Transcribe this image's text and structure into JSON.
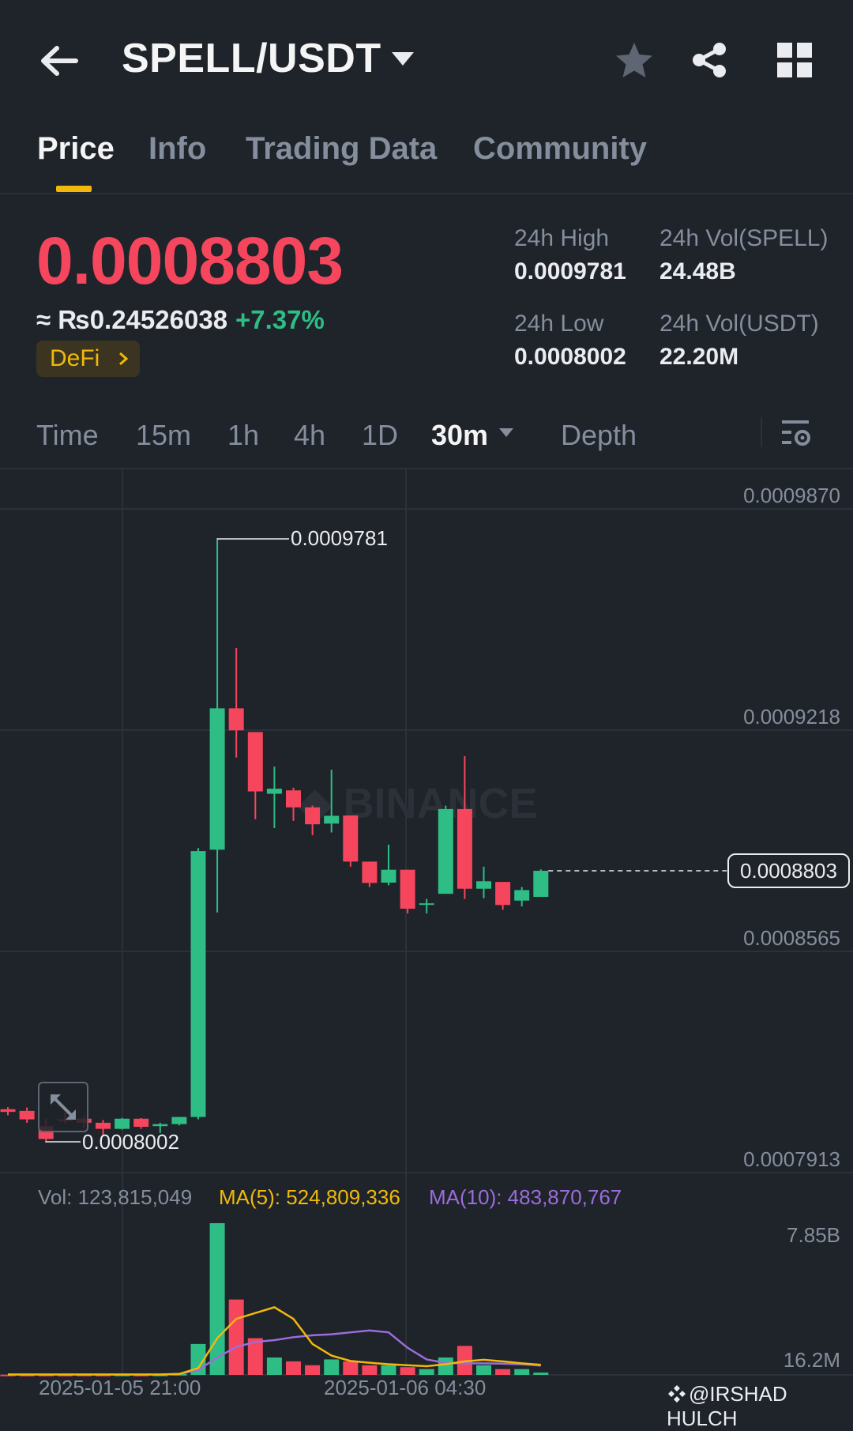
{
  "header": {
    "pair": "SPELL/USDT"
  },
  "tabs": [
    {
      "label": "Price",
      "active": true
    },
    {
      "label": "Info"
    },
    {
      "label": "Trading Data"
    },
    {
      "label": "Community"
    }
  ],
  "ticker": {
    "last_price": "0.0008803",
    "fiat_value": "≈ ₨0.24526038",
    "change_pct": "+7.37%",
    "tag": "DeFi",
    "high_label": "24h High",
    "high_value": "0.0009781",
    "low_label": "24h Low",
    "low_value": "0.0008002",
    "vol_base_label": "24h Vol(SPELL)",
    "vol_base_value": "24.48B",
    "vol_quote_label": "24h Vol(USDT)",
    "vol_quote_value": "22.20M"
  },
  "timeframes": {
    "time": "Time",
    "m15": "15m",
    "h1": "1h",
    "h4": "4h",
    "d1": "1D",
    "selected": "30m",
    "depth": "Depth"
  },
  "chart_data": {
    "type": "candlestick",
    "y_axis_ticks": [
      "0.0009870",
      "0.0009218",
      "0.0008565",
      "0.0007913"
    ],
    "ylim": [
      0.0007913,
      0.000987
    ],
    "high_marker": "0.0009781",
    "low_marker": "0.0008002",
    "current_price_label": "0.0008803",
    "x_labels": [
      "2025-01-05 21:00",
      "2025-01-06 04:30"
    ],
    "candles": [
      {
        "o": 0.00081,
        "h": 0.0008106,
        "l": 0.0008082,
        "c": 0.0008092
      },
      {
        "o": 0.0008095,
        "h": 0.0008105,
        "l": 0.000806,
        "c": 0.000807
      },
      {
        "o": 0.000805,
        "h": 0.0008072,
        "l": 0.0008002,
        "c": 0.0008012
      },
      {
        "o": 0.000807,
        "h": 0.000809,
        "l": 0.0008058,
        "c": 0.0008068
      },
      {
        "o": 0.0008072,
        "h": 0.000808,
        "l": 0.0008045,
        "c": 0.000806
      },
      {
        "o": 0.000806,
        "h": 0.0008068,
        "l": 0.000802,
        "c": 0.0008042
      },
      {
        "o": 0.0008042,
        "h": 0.0008074,
        "l": 0.000804,
        "c": 0.0008072
      },
      {
        "o": 0.0008072,
        "h": 0.0008074,
        "l": 0.0008042,
        "c": 0.0008048
      },
      {
        "o": 0.000805,
        "h": 0.000806,
        "l": 0.000803,
        "c": 0.0008056
      },
      {
        "o": 0.0008056,
        "h": 0.0008077,
        "l": 0.0008052,
        "c": 0.0008077
      },
      {
        "o": 0.0008077,
        "h": 0.000887,
        "l": 0.000807,
        "c": 0.0008861
      },
      {
        "o": 0.0008865,
        "h": 0.0009781,
        "l": 0.000868,
        "c": 0.0009282
      },
      {
        "o": 0.0009282,
        "h": 0.000946,
        "l": 0.0009137,
        "c": 0.0009217
      },
      {
        "o": 0.0009212,
        "h": 0.0009212,
        "l": 0.0008955,
        "c": 0.0009037
      },
      {
        "o": 0.000903,
        "h": 0.000911,
        "l": 0.0008929,
        "c": 0.0009045
      },
      {
        "o": 0.000904,
        "h": 0.0009048,
        "l": 0.000895,
        "c": 0.000899
      },
      {
        "o": 0.000899,
        "h": 0.0008995,
        "l": 0.0008908,
        "c": 0.000894
      },
      {
        "o": 0.0008942,
        "h": 0.0009101,
        "l": 0.0008916,
        "c": 0.0008965
      },
      {
        "o": 0.0008966,
        "h": 0.0008966,
        "l": 0.0008815,
        "c": 0.000883
      },
      {
        "o": 0.000883,
        "h": 0.000883,
        "l": 0.0008755,
        "c": 0.0008767
      },
      {
        "o": 0.0008768,
        "h": 0.000888,
        "l": 0.000876,
        "c": 0.0008806
      },
      {
        "o": 0.0008806,
        "h": 0.0008806,
        "l": 0.0008677,
        "c": 0.0008691
      },
      {
        "o": 0.0008706,
        "h": 0.000872,
        "l": 0.0008677,
        "c": 0.0008707
      },
      {
        "o": 0.0008735,
        "h": 0.0008995,
        "l": 0.0008735,
        "c": 0.0008985
      },
      {
        "o": 0.0008985,
        "h": 0.0009141,
        "l": 0.000872,
        "c": 0.000875
      },
      {
        "o": 0.000875,
        "h": 0.0008815,
        "l": 0.0008722,
        "c": 0.0008772
      },
      {
        "o": 0.000877,
        "h": 0.000877,
        "l": 0.0008688,
        "c": 0.0008702
      },
      {
        "o": 0.0008715,
        "h": 0.0008755,
        "l": 0.0008698,
        "c": 0.0008746
      },
      {
        "o": 0.0008726,
        "h": 0.0008807,
        "l": 0.0008726,
        "c": 0.0008803
      }
    ]
  },
  "volume": {
    "vol_label": "Vol: 123,815,049",
    "ma5_label": "MA(5): 524,809,336",
    "ma10_label": "MA(10): 483,870,767",
    "axis_top": "7.85B",
    "axis_bottom": "16.2M",
    "ylim": [
      0,
      7850000000
    ],
    "bars": [
      0.012,
      0.01,
      0.012,
      0.01,
      0.014,
      0.012,
      0.016,
      0.012,
      0.016,
      0.05,
      1.6,
      7.85,
      3.9,
      1.9,
      0.9,
      0.7,
      0.5,
      0.8,
      0.7,
      0.5,
      0.5,
      0.4,
      0.3,
      0.9,
      1.5,
      0.5,
      0.3,
      0.3,
      0.12
    ],
    "ma5": [
      0.02,
      0.02,
      0.02,
      0.02,
      0.02,
      0.02,
      0.02,
      0.02,
      0.02,
      0.05,
      0.35,
      1.9,
      2.9,
      3.2,
      3.5,
      2.9,
      1.6,
      1.0,
      0.72,
      0.63,
      0.55,
      0.5,
      0.45,
      0.55,
      0.7,
      0.78,
      0.7,
      0.6,
      0.52
    ],
    "ma10": [
      0.02,
      0.02,
      0.02,
      0.02,
      0.02,
      0.02,
      0.02,
      0.02,
      0.02,
      0.05,
      0.25,
      0.9,
      1.45,
      1.7,
      1.8,
      1.95,
      2.05,
      2.1,
      2.2,
      2.3,
      2.2,
      1.4,
      0.8,
      0.62,
      0.6,
      0.6,
      0.58,
      0.55,
      0.48
    ],
    "colors": {
      "up": "#2ebd85",
      "down": "#f6465d",
      "ma5": "#f0b90b",
      "ma10": "#9b6ddb"
    }
  },
  "watermark": "@IRSHAD HULCH"
}
